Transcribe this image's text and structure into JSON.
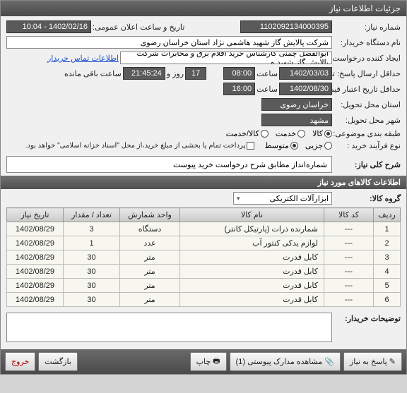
{
  "window": {
    "title": "جزئیات اطلاعات نیاز"
  },
  "f": {
    "req_no_l": "شماره نیاز:",
    "req_no": "1102092134000395",
    "ann_l": "تاریخ و ساعت اعلان عمومی:",
    "ann": "1402/02/16 - 10:04",
    "buyer_l": "نام دستگاه خریدار:",
    "buyer": "شرکت پالایش گاز شهید هاشمی نژاد   استان خراسان رضوی",
    "creator_l": "ایجاد کننده درخواست:",
    "creator": "ابوالفضل چمنی کارشناس خرید اقلام برق و مخابرات شرکت پالایش گاز شهید ه",
    "contact_link": "اطلاعات تماس خریدار",
    "deadline_l": "حداقل ارسال پاسخ: تا تاریخ:",
    "dl_date": "1402/03/03",
    "time_l": "ساعت",
    "dl_time": "08:00",
    "days": "17",
    "days_l": "روز و",
    "countdown": "21:45:24",
    "remain_l": "ساعت باقی مانده",
    "valid_l": "حداقل تاریخ اعتبار قیمت: تا تاریخ:",
    "v_date": "1402/08/30",
    "v_time": "16:00",
    "prov_l": "استان محل تحویل:",
    "prov": "خراسان رضوی",
    "city_l": "شهر محل تحویل:",
    "city": "مشهد",
    "cls_l": "طبقه بندی موضوعی:",
    "cls_goods": "کالا",
    "cls_srv": "خدمت",
    "cls_both": "کالا/خدمت",
    "proc_l": "نوع فرآیند خرید :",
    "p_low": "جزیی",
    "p_mid": "متوسط",
    "pay_note": "پرداخت تمام یا بخشی از مبلغ خرید،از محل \"اسناد خزانه اسلامی\" خواهد بود.",
    "desc_l": "شرح کلی نیاز:",
    "desc": "شماره‌انداز مطابق شرح درخواست خرید پیوست",
    "items_hdr": "اطلاعات کالاهای مورد نیاز",
    "group_l": "گروه کالا:",
    "group": "ابزارآلات الکتریکی",
    "notes_l": "توضیحات خریدار:"
  },
  "cols": {
    "row": "ردیف",
    "code": "کد کالا",
    "name": "نام کالا",
    "unit": "واحد شمارش",
    "qty": "تعداد / مقدار",
    "date": "تاریخ نیاز"
  },
  "items": [
    {
      "i": "1",
      "code": "---",
      "name": "شمارنده ذرات (پارتیکل کانتر)",
      "unit": "دستگاه",
      "qty": "3",
      "date": "1402/08/29"
    },
    {
      "i": "2",
      "code": "---",
      "name": "لوازم یدکی کنتور آب",
      "unit": "عدد",
      "qty": "1",
      "date": "1402/08/29"
    },
    {
      "i": "3",
      "code": "---",
      "name": "کابل قدرت",
      "unit": "متر",
      "qty": "30",
      "date": "1402/08/29"
    },
    {
      "i": "4",
      "code": "---",
      "name": "کابل قدرت",
      "unit": "متر",
      "qty": "30",
      "date": "1402/08/29"
    },
    {
      "i": "5",
      "code": "---",
      "name": "کابل قدرت",
      "unit": "متر",
      "qty": "30",
      "date": "1402/08/29"
    },
    {
      "i": "6",
      "code": "---",
      "name": "کابل قدرت",
      "unit": "متر",
      "qty": "30",
      "date": "1402/08/29"
    }
  ],
  "btns": {
    "reply": "پاسخ به نیاز",
    "attach": "مشاهده مدارک پیوستی (1)",
    "print": "چاپ",
    "back": "بازگشت",
    "exit": "خروج"
  }
}
